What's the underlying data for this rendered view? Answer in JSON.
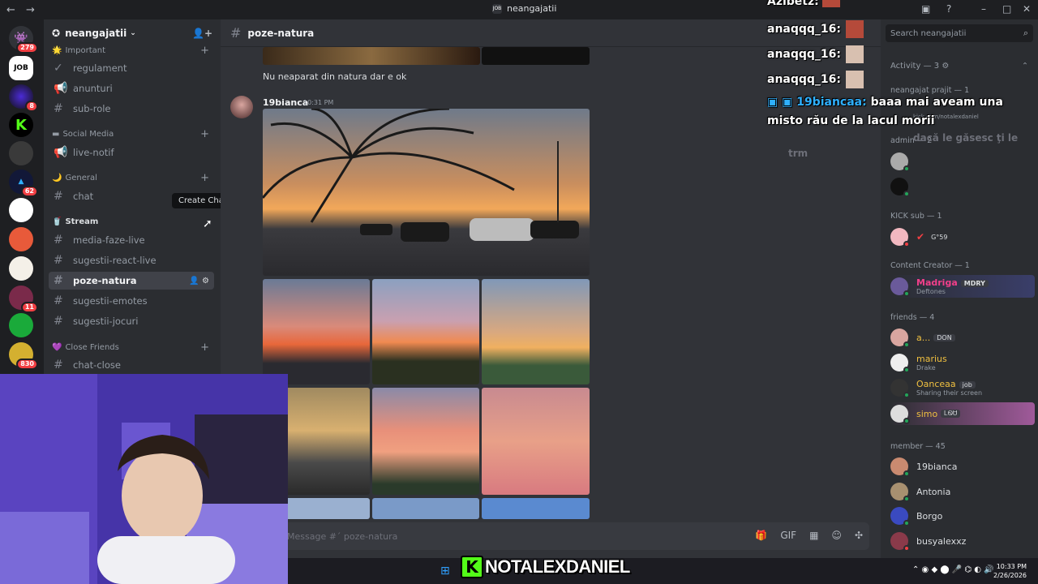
{
  "window": {
    "title": "neangajatii",
    "back_icon": "←",
    "forward_icon": "→"
  },
  "server": {
    "name": "neangajatii"
  },
  "sidebar": {
    "categories": [
      {
        "label": "Important",
        "icon": "🌟"
      },
      {
        "label": "Social Media",
        "icon": "▬"
      },
      {
        "label": "General",
        "icon": "🌙"
      },
      {
        "label": "Stream",
        "icon": "🥤"
      },
      {
        "label": "Close Friends",
        "icon": "💜"
      }
    ],
    "channels": [
      {
        "label": "regulament"
      },
      {
        "label": "anunturi"
      },
      {
        "label": "sub-role"
      },
      {
        "label": "live-notif"
      },
      {
        "label": "chat"
      },
      {
        "label": "media-faze-live"
      },
      {
        "label": "sugestii-react-live"
      },
      {
        "label": "poze-natura"
      },
      {
        "label": "sugestii-emotes"
      },
      {
        "label": "sugestii-jocuri"
      },
      {
        "label": "chat-close"
      }
    ],
    "tooltip": "Create Channel"
  },
  "rail": {
    "badges": [
      "279",
      "8",
      "62",
      "11",
      "830"
    ],
    "server_labels": [
      "JOB"
    ]
  },
  "channel": {
    "name": "poze-natura"
  },
  "messages": {
    "text": "Nu neaparat din natura dar e ok",
    "author": "19bianca",
    "time": "10:31 PM"
  },
  "composer": {
    "placeholder": "Message #´ poze-natura"
  },
  "members": {
    "search_placeholder": "Search neangajatii",
    "activity_header": "Activity — 3",
    "groups": {
      "neangajat": "neangajat prajit — 1",
      "admin": "admin — 2",
      "kick": "KICK sub — 1",
      "creator": "Content Creator — 1",
      "friends": "friends — 4",
      "member": "member — 45"
    },
    "activity_sub": "kick.com/notalexdaniel",
    "kick_member": "G°59",
    "creator": {
      "name": "Madriga",
      "tag": "MDRY",
      "sub": "Deftones"
    },
    "friends": [
      {
        "name": "a...",
        "tag": "DON",
        "sub": ""
      },
      {
        "name": "marius",
        "tag": "",
        "sub": "Drake"
      },
      {
        "name": "Oanceaa",
        "tag": "job",
        "sub": "Sharing their screen"
      },
      {
        "name": "simo",
        "tag": "ᏞᏫᏌ",
        "sub": ""
      }
    ],
    "members_list": [
      "19bianca",
      "Antonia",
      "Borgo",
      "busyalexxz"
    ]
  },
  "overlay": {
    "lines": [
      {
        "user": "Azibetz:",
        "text": ""
      },
      {
        "user": "anaqqq_16:",
        "text": ""
      },
      {
        "user": "anaqqq_16:",
        "text": ""
      },
      {
        "user": "anaqqq_16:",
        "text": ""
      },
      {
        "user": "19biancaa:",
        "text": "baaa mai aveam una"
      },
      {
        "user": "",
        "text": "misto rău de la lacul morii"
      },
      {
        "user": "",
        "text": "dacă le găsesc ţi le"
      },
      {
        "user": "",
        "text": "trm"
      }
    ]
  },
  "taskbar": {
    "time": "10:33 PM",
    "date": "2/26/2026"
  },
  "brand": {
    "letter": "K",
    "text": "NOTALEXDANIEL"
  }
}
